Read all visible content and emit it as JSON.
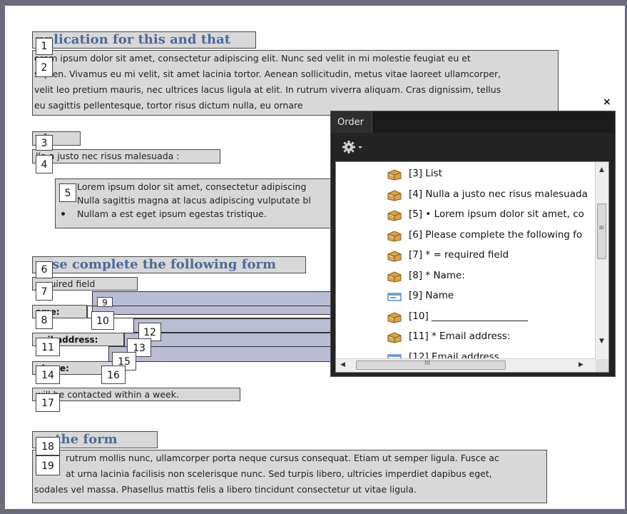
{
  "document": {
    "heading1": "Application for this and that",
    "heading1_visible": "pplication for this and that",
    "para1_lines": [
      "orem ipsum dolor sit amet, consectetur adipiscing elit. Nunc sed velit in mi molestie feugiat eu et",
      "sapien. Vivamus eu mi velit, sit amet lacinia tortor. Aenean sollicitudin, metus vitae laoreet ullamcorper,",
      "velit leo pretium mauris, nec ultrices lacus ligula at elit. In rutrum viverra aliquam. Cras dignissim, tellus",
      "eu sagittis pellentesque, tortor risus dictum nulla, eu ornare"
    ],
    "heading2_visible": "st",
    "list_intro": "lla a justo nec risus malesuada :",
    "list_items": [
      "Lorem ipsum dolor sit amet, consectetur adipiscing",
      "Nulla sagittis magna at lacus adipiscing vulputate bl",
      "Nullam a est eget ipsum egestas tristique."
    ],
    "heading3_visible": "ease complete the following form",
    "required_note": "required field",
    "name_label": "ame:",
    "email_label": "nail address:",
    "phone_label": "phone:",
    "contact_note": "will be contacted within a week.",
    "heading4_visible": "er the form",
    "para2_lines": [
      "rutrum mollis nunc, ullamcorper porta neque cursus consequat. Etiam ut semper ligula. Fusce ac",
      "at urna lacinia facilisis non scelerisque nunc. Sed turpis libero, ultricies imperdiet dapibus eget,",
      "sodales vel massa. Phasellus mattis felis a libero tincidunt consectetur ut vitae ligula."
    ]
  },
  "tag_numbers": [
    "1",
    "2",
    "3",
    "4",
    "5",
    "6",
    "7",
    "8",
    "9",
    "10",
    "11",
    "12",
    "13",
    "14",
    "15",
    "16",
    "17",
    "18",
    "19"
  ],
  "order_panel": {
    "close_glyph": "×",
    "tab_label": "Order",
    "gear_icon": "gear-icon",
    "items": [
      {
        "text": "[3]  List",
        "icon": "tag-icon"
      },
      {
        "text": "[4]  Nulla a justo nec risus malesuada",
        "icon": "tag-icon"
      },
      {
        "text": "[5]  • Lorem ipsum dolor sit amet, co",
        "icon": "tag-icon"
      },
      {
        "text": "[6]  Please complete the following fo",
        "icon": "tag-icon"
      },
      {
        "text": "[7]  * = required field",
        "icon": "tag-icon"
      },
      {
        "text": "[8]  * Name:",
        "icon": "tag-icon"
      },
      {
        "text": "[9]  Name",
        "icon": "form-field-icon"
      },
      {
        "text": "[10]  ____________________",
        "icon": "tag-icon"
      },
      {
        "text": "[11]  * Email address:",
        "icon": "tag-icon"
      },
      {
        "text": "[12]  Email address",
        "icon": "form-field-icon"
      }
    ],
    "hscroll_glyph": "III",
    "vscroll_glyph": "≡"
  },
  "colors": {
    "frame": "#6b6b7d",
    "highlight": "#d8d8d8",
    "field": "#b9bdd4",
    "heading": "#4a6a9a",
    "panel_bg": "#232323"
  }
}
